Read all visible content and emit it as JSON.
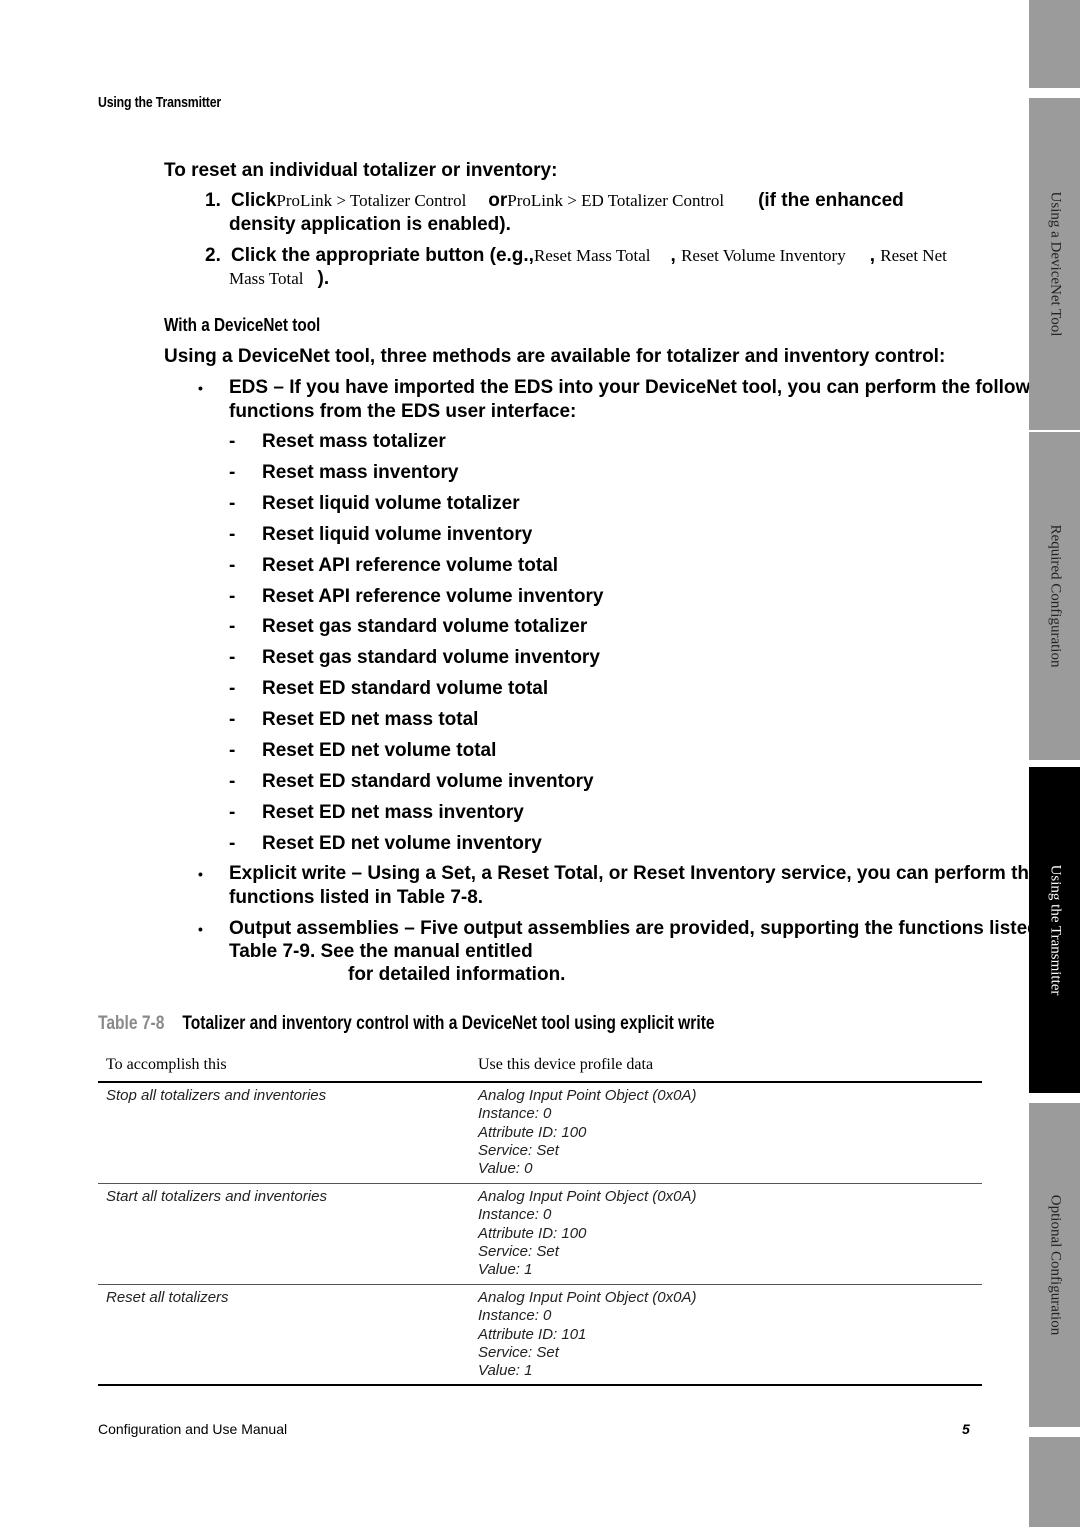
{
  "running_head": "Using the Transmitter",
  "procedure": {
    "heading": "To reset an individual totalizer or inventory:",
    "steps": [
      {
        "num": "1.",
        "pre": "Click",
        "path1": "ProLink > Totalizer Control",
        "mid": "or",
        "path2": "ProLink > ED Totalizer Control",
        "post": "(if the enhanced",
        "line2": "density application is enabled)."
      },
      {
        "num": "2.",
        "pre": "Click the appropriate button (e.g.,",
        "btn1": "Reset Mass Total",
        "sep1": ",",
        "btn2": "Reset Volume Inventory",
        "sep2": ",",
        "btn3a": "Reset Net",
        "btn3b": "Mass Total",
        "post": ")."
      }
    ]
  },
  "devicenet": {
    "subheading": "With a DeviceNet tool",
    "intro": "Using a DeviceNet tool, three methods are available for totalizer and inventory control:",
    "bullets": [
      {
        "line1": "EDS – If you have imported the EDS into your DeviceNet tool, you can perform the following",
        "line2": "functions from the EDS user interface:"
      },
      {
        "line1": "Explicit write – Using a Set, a Reset Total, or Reset Inventory service, you can perform the",
        "line2": "functions listed in Table 7-8."
      },
      {
        "line1": "Output assemblies – Five output assemblies are provided, supporting the functions listed in",
        "line2": "Table 7-9. See the manual entitled",
        "line3": "for detailed information."
      }
    ],
    "eds_functions": [
      "Reset mass totalizer",
      "Reset mass inventory",
      "Reset liquid volume totalizer",
      "Reset liquid volume inventory",
      "Reset API reference volume total",
      "Reset API reference volume inventory",
      "Reset gas standard volume totalizer",
      "Reset gas standard volume inventory",
      "Reset ED standard volume total",
      "Reset ED net mass total",
      "Reset ED net volume total",
      "Reset ED standard volume inventory",
      "Reset ED net mass inventory",
      "Reset ED net volume inventory"
    ],
    "dash": "-",
    "bullet": "•"
  },
  "table": {
    "number": "Table 7-8",
    "title": "Totalizer and inventory control with a DeviceNet tool using explicit write",
    "headers": [
      "To accomplish this",
      "Use this device profile data"
    ],
    "rows": [
      {
        "action": "Stop all totalizers and inventories",
        "data": [
          "Analog Input Point Object (0x0A)",
          "Instance: 0",
          "Attribute ID: 100",
          "Service: Set",
          "Value: 0"
        ]
      },
      {
        "action": "Start all totalizers and inventories",
        "data": [
          "Analog Input Point Object (0x0A)",
          "Instance: 0",
          "Attribute ID: 100",
          "Service: Set",
          "Value: 1"
        ]
      },
      {
        "action": "Reset all totalizers",
        "data": [
          "Analog Input Point Object (0x0A)",
          "Instance: 0",
          "Attribute ID: 101",
          "Service: Set",
          "Value: 1"
        ]
      }
    ]
  },
  "footer": {
    "left": "Configuration and Use Manual",
    "page": "5"
  },
  "side_tabs": [
    {
      "label": "",
      "active": false
    },
    {
      "label": "Using a DeviceNet Tool",
      "active": false
    },
    {
      "label": "Required Configuration",
      "active": false
    },
    {
      "label": "Using the Transmitter",
      "active": true
    },
    {
      "label": "Optional Configuration",
      "active": false
    },
    {
      "label": "",
      "active": false
    }
  ],
  "colors": {
    "tab_inactive": "#9b9b9b",
    "tab_active": "#000000",
    "table_number": "#8a8a8a"
  }
}
